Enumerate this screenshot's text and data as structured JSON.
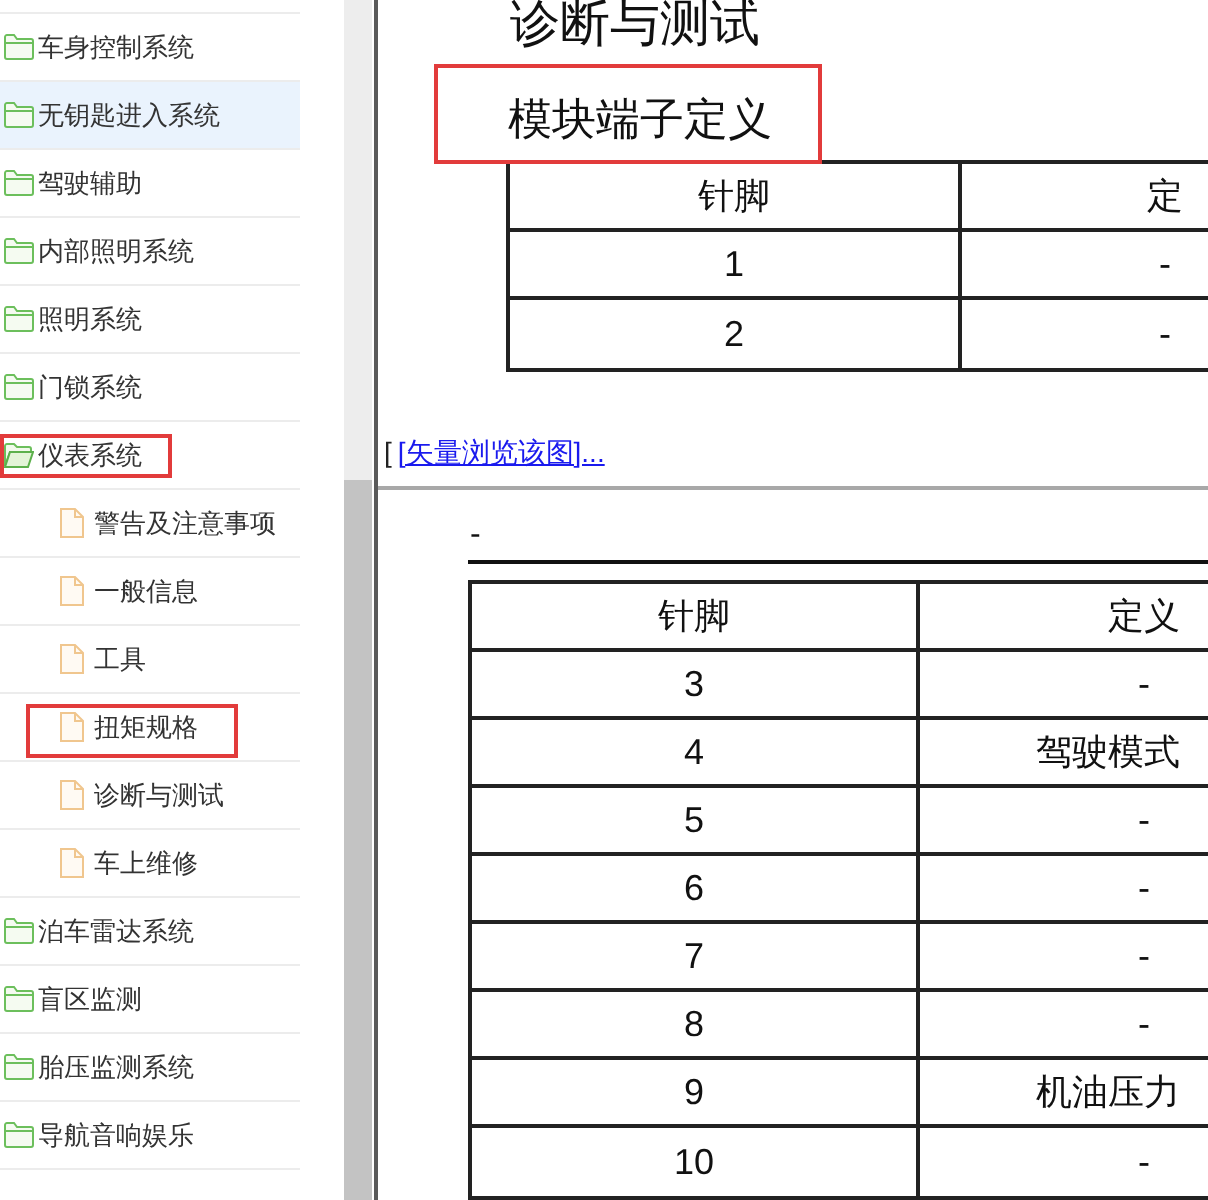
{
  "sidebar": {
    "items": [
      {
        "label": "车身控制系统",
        "selected": false,
        "expanded": false,
        "boxed": false
      },
      {
        "label": "无钥匙进入系统",
        "selected": true,
        "expanded": false,
        "boxed": false
      },
      {
        "label": "驾驶辅助",
        "selected": false,
        "expanded": false,
        "boxed": false
      },
      {
        "label": "内部照明系统",
        "selected": false,
        "expanded": false,
        "boxed": false
      },
      {
        "label": "照明系统",
        "selected": false,
        "expanded": false,
        "boxed": false
      },
      {
        "label": "门锁系统",
        "selected": false,
        "expanded": false,
        "boxed": false
      },
      {
        "label": "仪表系统",
        "selected": false,
        "expanded": true,
        "boxed": true,
        "children": [
          {
            "label": "警告及注意事项",
            "selected": false,
            "boxed": false
          },
          {
            "label": "一般信息",
            "selected": false,
            "boxed": false
          },
          {
            "label": "工具",
            "selected": false,
            "boxed": false
          },
          {
            "label": "扭矩规格",
            "selected": false,
            "boxed": true
          },
          {
            "label": "诊断与测试",
            "selected": false,
            "boxed": false
          },
          {
            "label": "车上维修",
            "selected": false,
            "boxed": false
          }
        ]
      },
      {
        "label": "泊车雷达系统",
        "selected": false,
        "expanded": false,
        "boxed": false
      },
      {
        "label": "盲区监测",
        "selected": false,
        "expanded": false,
        "boxed": false
      },
      {
        "label": "胎压监测系统",
        "selected": false,
        "expanded": false,
        "boxed": false
      },
      {
        "label": "导航音响娱乐",
        "selected": false,
        "expanded": false,
        "boxed": false
      }
    ]
  },
  "content": {
    "page_title": "诊断与测试",
    "section_heading": {
      "text": "模块端子定义",
      "boxed": true
    },
    "table_1": {
      "columns": [
        "针脚",
        "定"
      ],
      "rows": [
        {
          "pin": "1",
          "definition": "-",
          "clipped": false
        },
        {
          "pin": "2",
          "definition": "-",
          "clipped": false
        }
      ]
    },
    "vector_link": {
      "prefix": "[",
      "label": "[矢量浏览该图]..."
    },
    "caption": "-",
    "table_2": {
      "columns": [
        "针脚",
        "定义"
      ],
      "rows": [
        {
          "pin": "3",
          "definition": "-",
          "clipped": false
        },
        {
          "pin": "4",
          "definition": "驾驶模式",
          "clipped": true
        },
        {
          "pin": "5",
          "definition": "-",
          "clipped": false
        },
        {
          "pin": "6",
          "definition": "-",
          "clipped": false
        },
        {
          "pin": "7",
          "definition": "-",
          "clipped": false
        },
        {
          "pin": "8",
          "definition": "-",
          "clipped": false
        },
        {
          "pin": "9",
          "definition": "机油压力",
          "clipped": true
        },
        {
          "pin": "10",
          "definition": "-",
          "clipped": false
        }
      ]
    }
  }
}
